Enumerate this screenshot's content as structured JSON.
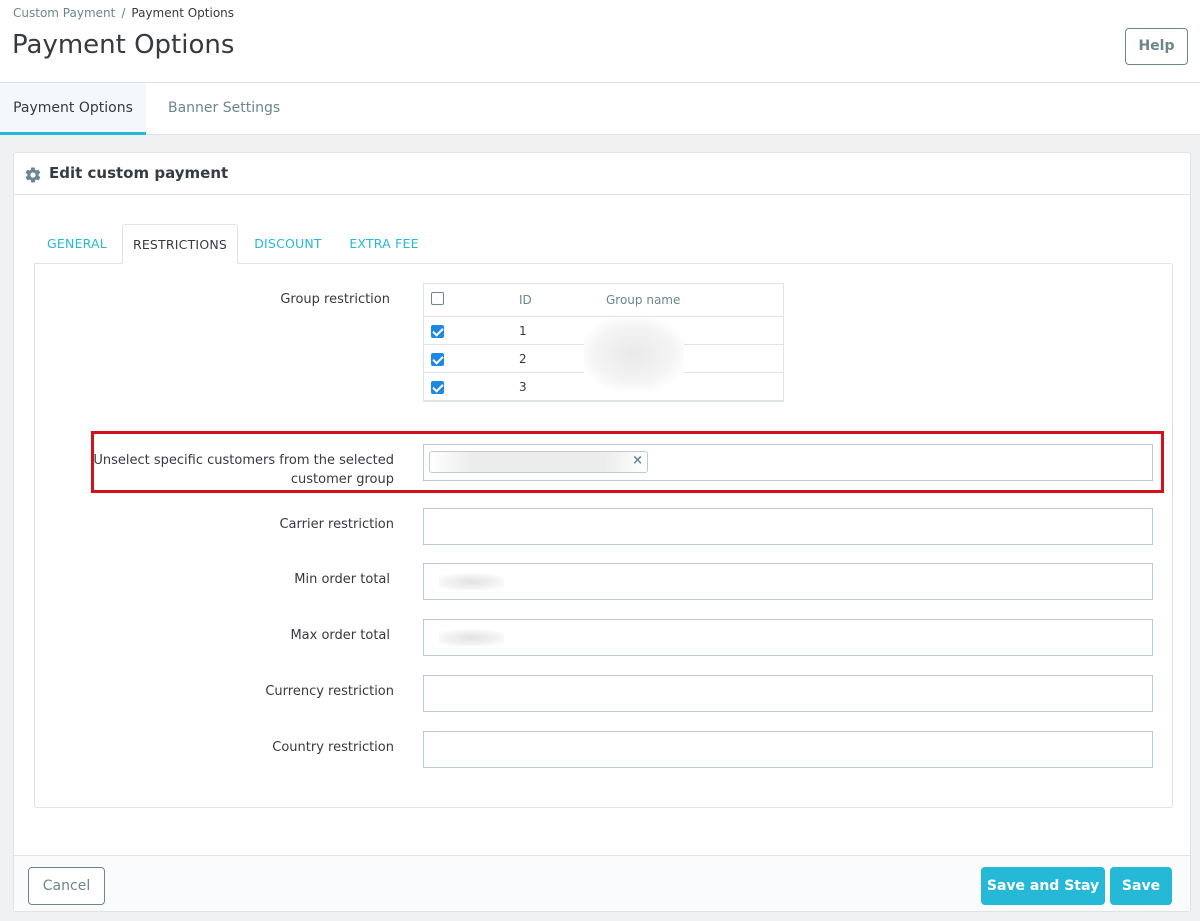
{
  "breadcrumb": {
    "parent": "Custom Payment",
    "separator": "/",
    "current": "Payment Options"
  },
  "page": {
    "title": "Payment Options",
    "help_label": "Help"
  },
  "top_tabs": [
    {
      "label": "Payment Options",
      "active": true
    },
    {
      "label": "Banner Settings",
      "active": false
    }
  ],
  "panel": {
    "title": "Edit custom payment",
    "icon": "gear-icon"
  },
  "inner_tabs": [
    {
      "label": "GENERAL",
      "active": false
    },
    {
      "label": "RESTRICTIONS",
      "active": true
    },
    {
      "label": "DISCOUNT",
      "active": false
    },
    {
      "label": "EXTRA FEE",
      "active": false
    }
  ],
  "form": {
    "group_restriction": {
      "label": "Group restriction",
      "columns": {
        "id": "ID",
        "name": "Group name"
      },
      "select_all_checked": false,
      "rows": [
        {
          "id": "1",
          "checked": true
        },
        {
          "id": "2",
          "checked": true
        },
        {
          "id": "3",
          "checked": true
        }
      ]
    },
    "unselect_customers": {
      "label_line1": "Unselect specific customers from the selected",
      "label_line2": "customer group",
      "chip_remove": "×"
    },
    "carrier_restriction": {
      "label": "Carrier restriction"
    },
    "min_order_total": {
      "label": "Min order total"
    },
    "max_order_total": {
      "label": "Max order total"
    },
    "currency_restriction": {
      "label": "Currency restriction"
    },
    "country_restriction": {
      "label": "Country restriction"
    }
  },
  "footer": {
    "cancel_label": "Cancel",
    "save_stay_label": "Save and Stay",
    "save_label": "Save"
  },
  "colors": {
    "accent": "#25b9d7",
    "highlight": "#d3111a",
    "checkbox": "#1e88e5"
  }
}
